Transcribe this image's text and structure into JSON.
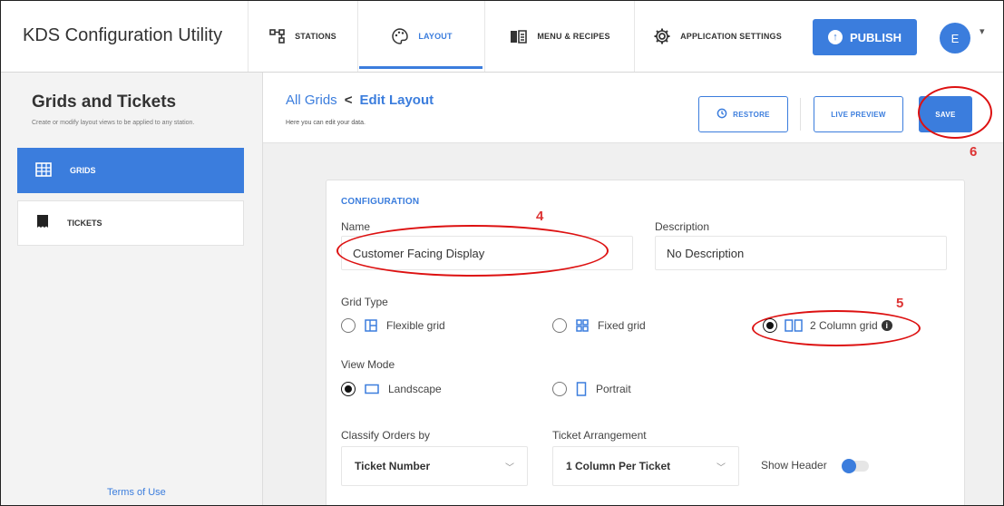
{
  "app": {
    "title": "KDS Configuration Utility"
  },
  "nav": {
    "stations": "STATIONS",
    "layout": "LAYOUT",
    "menu": "MENU & RECIPES",
    "settings": "APPLICATION SETTINGS",
    "publish": "PUBLISH",
    "avatar_initial": "E"
  },
  "sidebar": {
    "title": "Grids and Tickets",
    "subtitle": "Create or modify layout views to be applied to any station.",
    "items": [
      {
        "label": "GRIDS"
      },
      {
        "label": "TICKETS"
      }
    ],
    "terms": "Terms of Use"
  },
  "header": {
    "crumb_root": "All Grids",
    "crumb_arrow": "<",
    "crumb_current": "Edit Layout",
    "subtitle": "Here you can edit your data.",
    "restore": "RESTORE",
    "live_preview": "LIVE PREVIEW",
    "save": "SAVE"
  },
  "config": {
    "section_title": "CONFIGURATION",
    "name_label": "Name",
    "name_value": "Customer Facing Display",
    "description_label": "Description",
    "description_value": "No Description",
    "grid_type_label": "Grid Type",
    "grid_types": [
      {
        "label": "Flexible grid",
        "selected": false
      },
      {
        "label": "Fixed grid",
        "selected": false
      },
      {
        "label": "2 Column grid",
        "selected": true
      }
    ],
    "view_mode_label": "View Mode",
    "view_modes": [
      {
        "label": "Landscape",
        "selected": true
      },
      {
        "label": "Portrait",
        "selected": false
      }
    ],
    "classify_label": "Classify Orders by",
    "classify_value": "Ticket Number",
    "arrangement_label": "Ticket Arrangement",
    "arrangement_value": "1 Column Per Ticket",
    "show_header_label": "Show Header",
    "show_header_on": true
  },
  "annotations": {
    "n4": "4",
    "n5": "5",
    "n6": "6"
  },
  "colors": {
    "accent": "#3b7ddd",
    "annotation": "#dd1111"
  }
}
